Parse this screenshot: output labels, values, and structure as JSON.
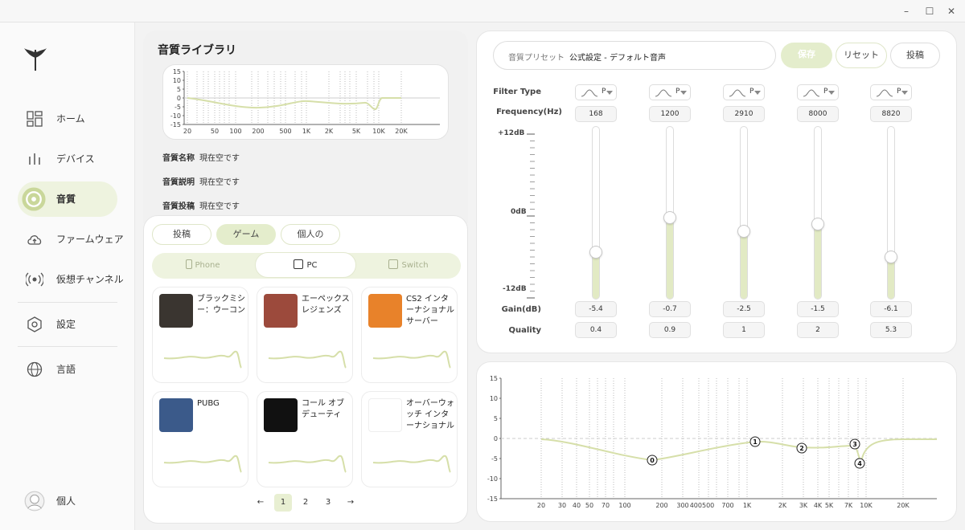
{
  "window": {
    "minimize": "–",
    "maximize": "☐",
    "close": "✕"
  },
  "sidebar": {
    "items": [
      {
        "label": "ホーム",
        "icon": "dashboard-icon"
      },
      {
        "label": "デバイス",
        "icon": "equalizer-icon"
      },
      {
        "label": "音質",
        "icon": "audio-icon",
        "active": true
      },
      {
        "label": "ファームウェア",
        "icon": "cloud-upload-icon"
      },
      {
        "label": "仮想チャンネル",
        "icon": "surround-icon"
      },
      {
        "label": "設定",
        "icon": "hexagon-settings-icon"
      },
      {
        "label": "言語",
        "icon": "globe-icon"
      }
    ],
    "user": "個人"
  },
  "library": {
    "title": "音質ライブラリ",
    "mini_chart": {
      "y_ticks": [
        "15",
        "10",
        "5",
        "0",
        "-5",
        "-10",
        "-15"
      ],
      "x_ticks": [
        "20",
        "50",
        "100",
        "200",
        "500",
        "1K",
        "2K",
        "5K",
        "10K",
        "20K"
      ]
    },
    "info": [
      {
        "label": "音質名称",
        "value": "現在空です"
      },
      {
        "label": "音質説明",
        "value": "現在空です"
      },
      {
        "label": "音質投稿",
        "value": "現在空です"
      }
    ],
    "tabs": [
      "投稿",
      "ゲーム",
      "個人の"
    ],
    "platforms": [
      "Phone",
      "PC",
      "Switch"
    ],
    "games": [
      {
        "name": "ブラックミシー：ウーコン",
        "color": "#3a3530"
      },
      {
        "name": "エーペックスレジェンズ",
        "color": "#9c4a3c"
      },
      {
        "name": "CS2 インターナショナルサーバー",
        "color": "#e8822a"
      },
      {
        "name": "PUBG",
        "color": "#3b5a8a"
      },
      {
        "name": "コール オブ デューティ",
        "color": "#111111"
      },
      {
        "name": "オーバーウォッチ インターナショナル",
        "color": "#ffffff"
      }
    ],
    "pager": {
      "prev": "←",
      "pages": [
        "1",
        "2",
        "3"
      ],
      "next": "→"
    }
  },
  "eq": {
    "preset_label": "音質プリセット",
    "preset_value": "公式設定 - デフォルト音声",
    "save": "保存",
    "reset": "リセット",
    "post": "投稿",
    "labels": {
      "filter_type": "Filter Type",
      "frequency": "Frequency(Hz)",
      "gain": "Gain(dB)",
      "quality": "Quality"
    },
    "db_labels": [
      "+12dB",
      "0dB",
      "-12dB"
    ],
    "filter_letter": "P",
    "bands": [
      {
        "freq": "168",
        "gain": "-5.4",
        "q": "0.4",
        "gain_value": -5.4
      },
      {
        "freq": "1200",
        "gain": "-0.7",
        "q": "0.9",
        "gain_value": -0.7
      },
      {
        "freq": "2910",
        "gain": "-2.5",
        "q": "1",
        "gain_value": -2.5
      },
      {
        "freq": "8000",
        "gain": "-1.5",
        "q": "2",
        "gain_value": -1.5
      },
      {
        "freq": "8820",
        "gain": "-6.1",
        "q": "5.3",
        "gain_value": -6.1
      }
    ]
  },
  "response": {
    "y_ticks": [
      "15",
      "10",
      "5",
      "0",
      "-5",
      "-10",
      "-15"
    ],
    "x_ticks": [
      "20",
      "30",
      "40",
      "50",
      "70",
      "100",
      "200",
      "300",
      "400500",
      "700",
      "1K",
      "2K",
      "3K",
      "4K",
      "5K",
      "7K",
      "10K",
      "20K"
    ],
    "markers": [
      "0",
      "1",
      "2",
      "3",
      "4"
    ]
  },
  "colors": {
    "accent": "#e4edcc",
    "accent_dark": "#c9d79a",
    "curve": "#d6dfa9"
  }
}
